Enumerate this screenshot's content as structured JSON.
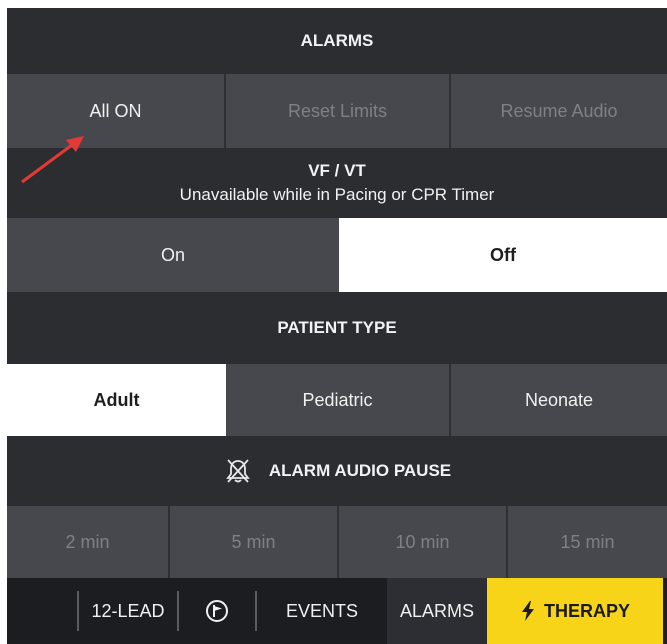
{
  "alarms": {
    "header": "ALARMS",
    "buttons": [
      "All ON",
      "Reset Limits",
      "Resume Audio"
    ]
  },
  "vfvt": {
    "title": "VF / VT",
    "subtitle": "Unavailable while in Pacing or CPR Timer",
    "options": [
      "On",
      "Off"
    ],
    "selected": "Off"
  },
  "patient_type": {
    "header": "PATIENT TYPE",
    "options": [
      "Adult",
      "Pediatric",
      "Neonate"
    ],
    "selected": "Adult"
  },
  "audio_pause": {
    "header": "ALARM AUDIO PAUSE",
    "icon": "alarm-silenced-icon",
    "options": [
      "2 min",
      "5 min",
      "10 min",
      "15 min"
    ]
  },
  "footer": {
    "lead": "12-LEAD",
    "flag_icon": "flag-icon",
    "events": "EVENTS",
    "alarms": "ALARMS",
    "therapy": "THERAPY",
    "therapy_icon": "lightning-bolt-icon"
  },
  "colors": {
    "background": "#34363b",
    "header": "#2b2d31",
    "button": "#46484e",
    "selected": "#ffffff",
    "therapy": "#f7d417",
    "annotation_arrow": "#e53935"
  }
}
